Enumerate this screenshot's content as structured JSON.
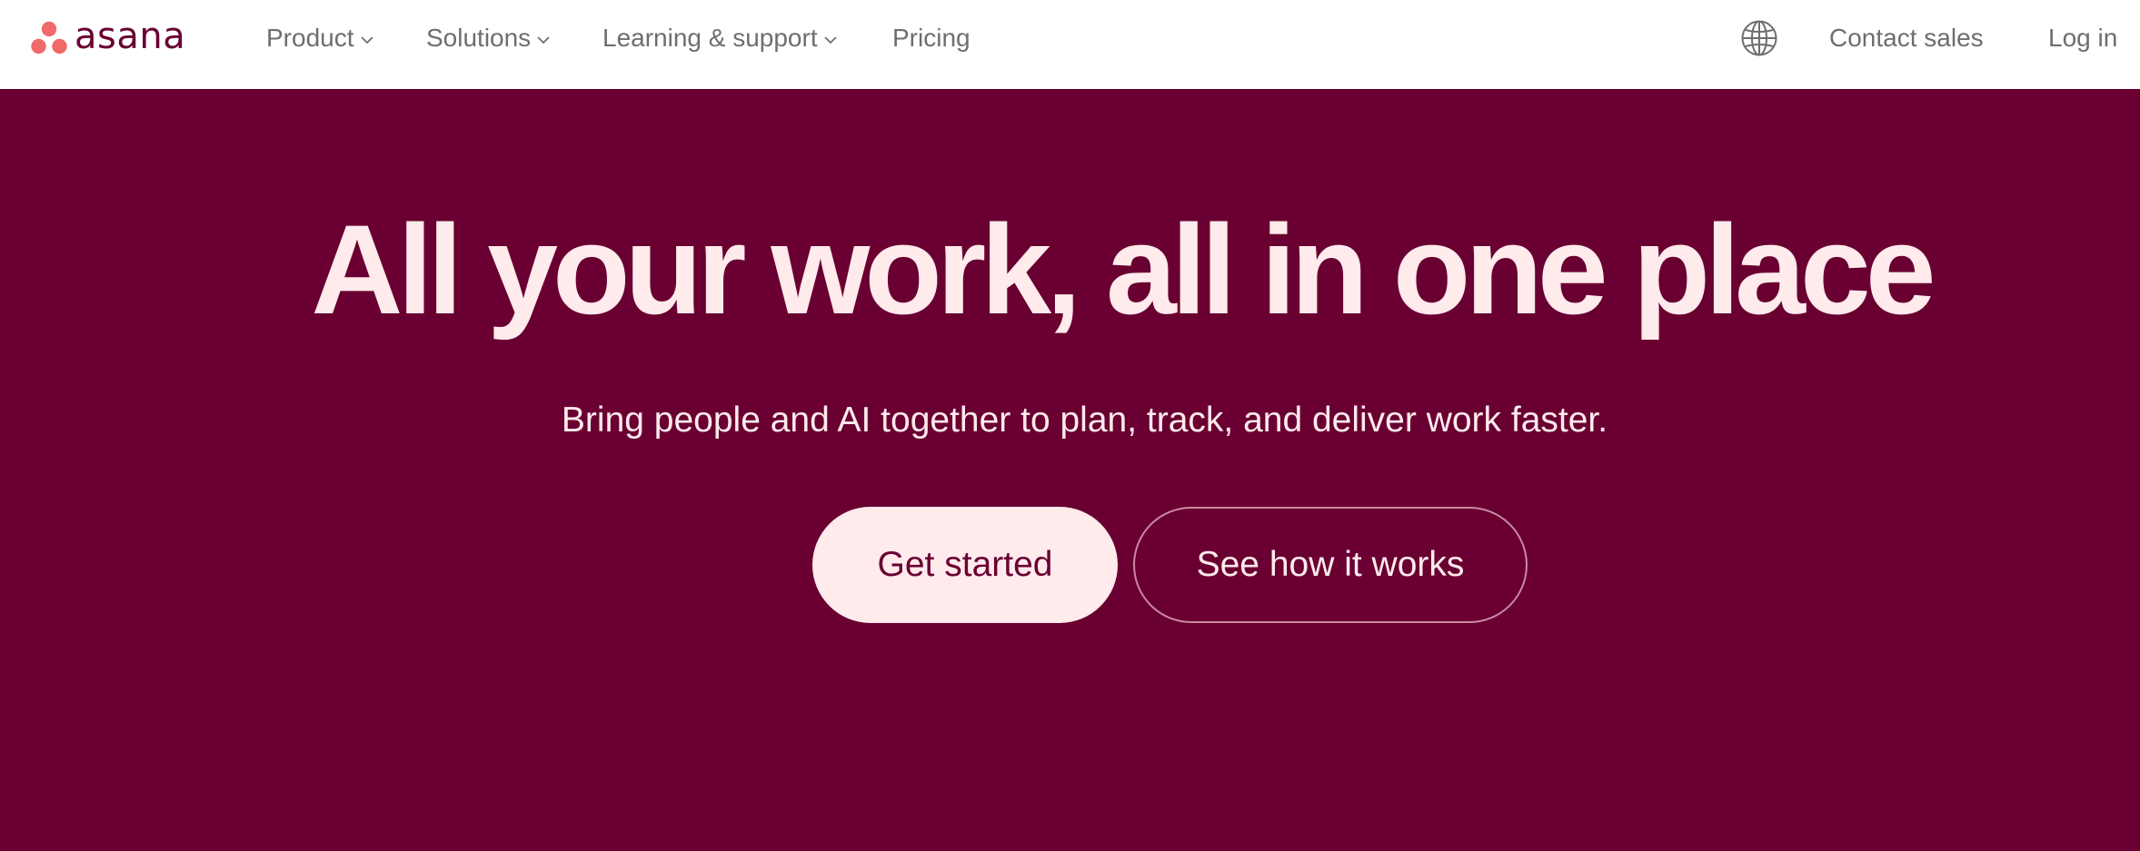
{
  "nav": {
    "logo_text": "asana",
    "items": [
      {
        "label": "Product",
        "has_dropdown": true
      },
      {
        "label": "Solutions",
        "has_dropdown": true
      },
      {
        "label": "Learning & support",
        "has_dropdown": true
      },
      {
        "label": "Pricing",
        "has_dropdown": false
      }
    ],
    "language_icon": "globe-icon",
    "contact_sales": "Contact sales",
    "log_in": "Log in"
  },
  "hero": {
    "title": "All your work, all in one place",
    "subtitle": "Bring people and AI together to plan, track, and deliver work faster.",
    "primary_button": "Get started",
    "secondary_button": "See how it works"
  },
  "colors": {
    "brand": "#690031",
    "hero_background": "#690031",
    "hero_text": "#ffeaec",
    "logo_dots": "#f06a6a",
    "nav_text": "#6d6e6f",
    "nav_background": "#ffffff"
  }
}
